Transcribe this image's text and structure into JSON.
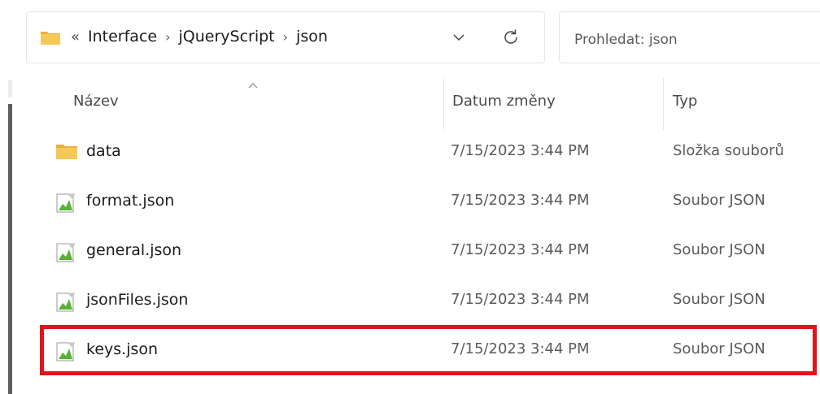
{
  "address_bar": {
    "overflow_glyph": "«",
    "breadcrumbs": [
      "Interface",
      "jQueryScript",
      "json"
    ],
    "separator": "›"
  },
  "search": {
    "placeholder": "Prohledat: json"
  },
  "columns": {
    "name": "Název",
    "date": "Datum změny",
    "type": "Typ"
  },
  "rows": [
    {
      "name": "data",
      "date": "7/15/2023 3:44 PM",
      "type": "Složka souborů",
      "icon": "folder-icon"
    },
    {
      "name": "format.json",
      "date": "7/15/2023 3:44 PM",
      "type": "Soubor JSON",
      "icon": "json-file-icon"
    },
    {
      "name": "general.json",
      "date": "7/15/2023 3:44 PM",
      "type": "Soubor JSON",
      "icon": "json-file-icon"
    },
    {
      "name": "jsonFiles.json",
      "date": "7/15/2023 3:44 PM",
      "type": "Soubor JSON",
      "icon": "json-file-icon"
    },
    {
      "name": "keys.json",
      "date": "7/15/2023 3:44 PM",
      "type": "Soubor JSON",
      "icon": "json-file-icon"
    }
  ],
  "colors": {
    "highlight": "#e3131a",
    "folder": "#f3c55c"
  }
}
